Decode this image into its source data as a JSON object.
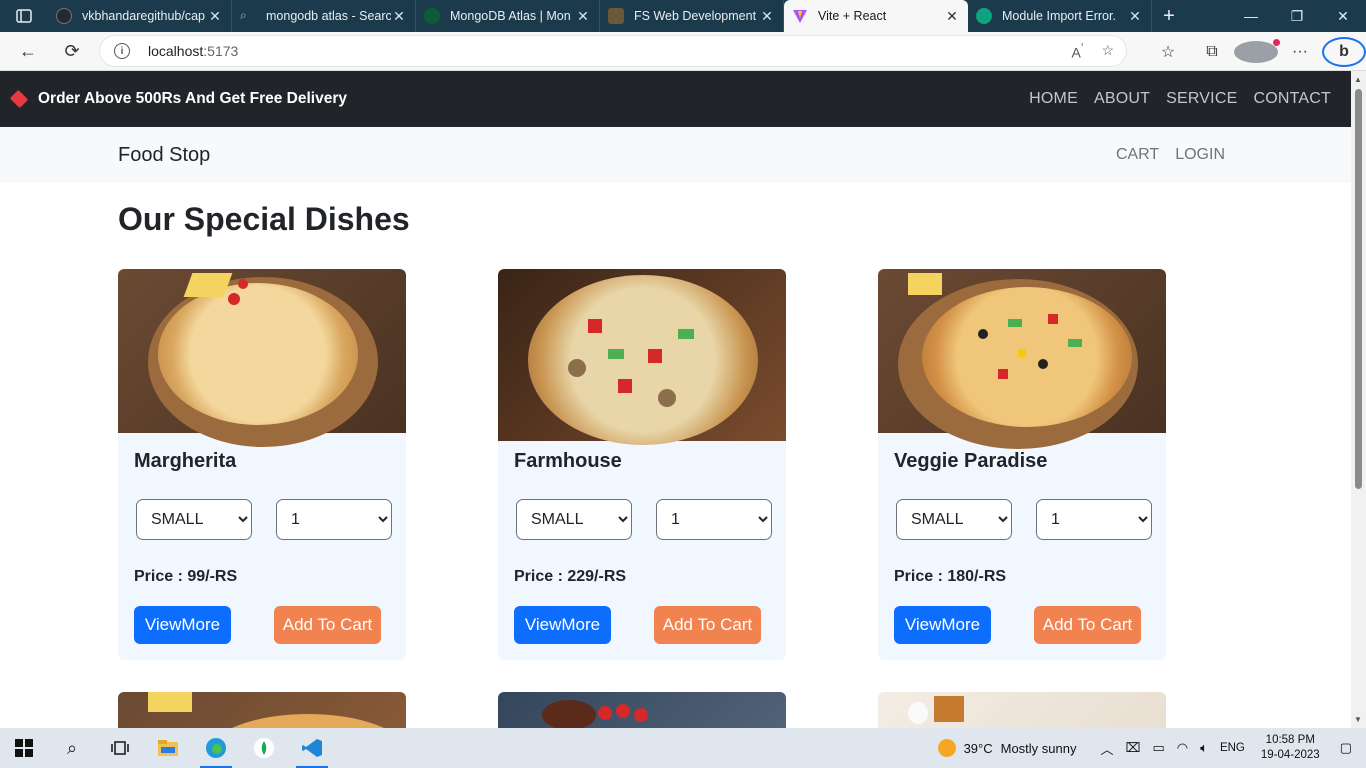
{
  "browser": {
    "tabs": [
      {
        "title": "vkbhandaregithub/cap",
        "color": "#24292f"
      },
      {
        "title": "mongodb atlas - Searc",
        "color": "#1b3b4d"
      },
      {
        "title": "MongoDB Atlas | Mon",
        "color": "#13aa52"
      },
      {
        "title": "FS Web Development",
        "color": "#6b5a3a"
      },
      {
        "title": "Vite + React",
        "color": "#a855f7",
        "active": true
      },
      {
        "title": "Module Import Error.",
        "color": "#10a37f"
      }
    ],
    "url_host": "localhost",
    "url_port": ":5173"
  },
  "site": {
    "promo": "Order Above 500Rs And Get Free Delivery",
    "top_links": [
      "HOME",
      "ABOUT",
      "SERVICE",
      "CONTACT"
    ],
    "brand": "Food Stop",
    "sub_links": [
      "CART",
      "LOGIN"
    ],
    "heading": "Our Special Dishes"
  },
  "dishes": [
    {
      "name": "Margherita",
      "size": "SMALL",
      "qty": "1",
      "price": "Price : 99/-RS",
      "view": "ViewMore",
      "cart": "Add To Cart"
    },
    {
      "name": "Farmhouse",
      "size": "SMALL",
      "qty": "1",
      "price": "Price : 229/-RS",
      "view": "ViewMore",
      "cart": "Add To Cart"
    },
    {
      "name": "Veggie Paradise",
      "size": "SMALL",
      "qty": "1",
      "price": "Price : 180/-RS",
      "view": "ViewMore",
      "cart": "Add To Cart"
    }
  ],
  "taskbar": {
    "temperature": "39°C",
    "weather": "Mostly sunny",
    "lang": "ENG",
    "time": "10:58 PM",
    "date": "19-04-2023"
  }
}
